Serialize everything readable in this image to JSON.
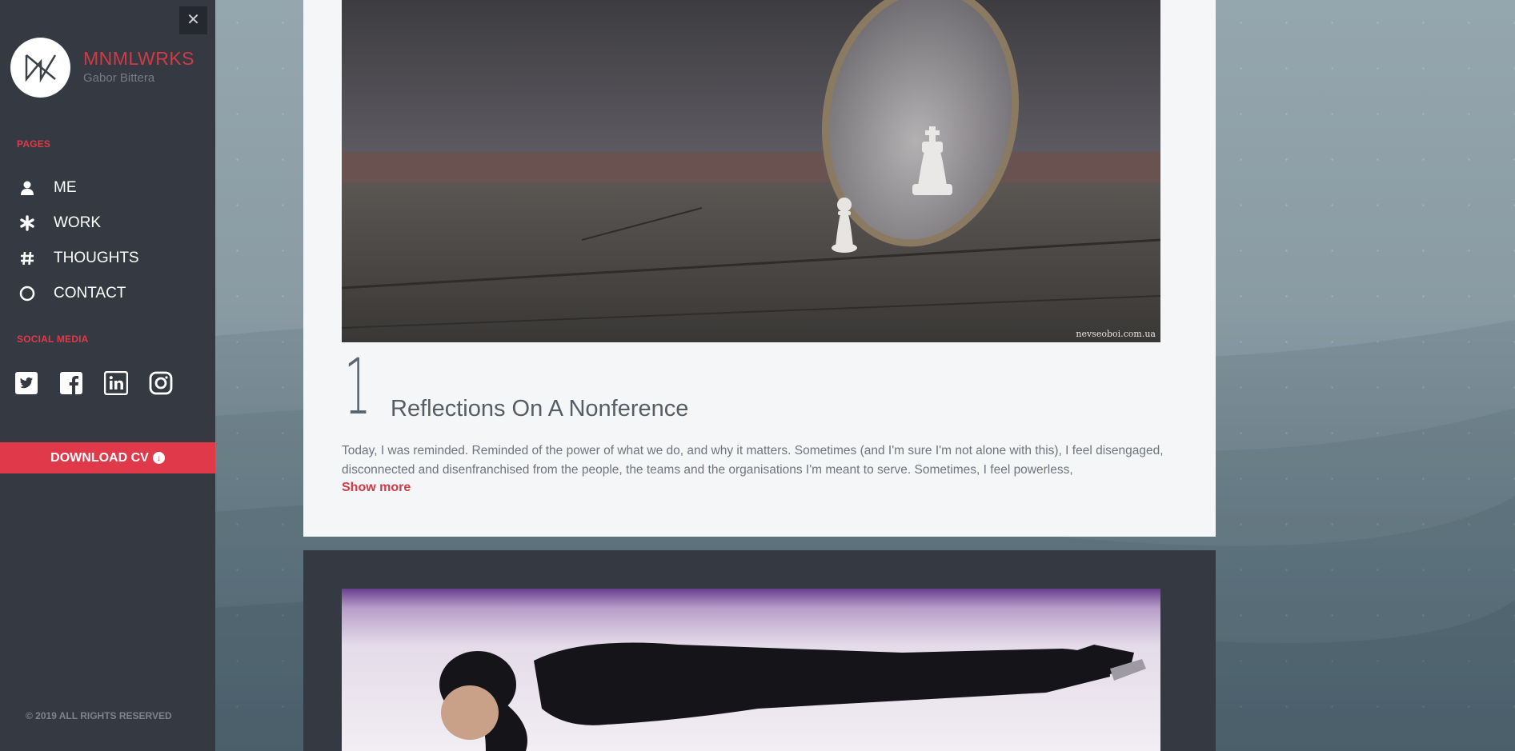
{
  "sidebar": {
    "brand_name": "MNMLWRKS",
    "brand_sub": "Gabor Bittera",
    "close_label": "✕",
    "pages_label": "PAGES",
    "nav": [
      {
        "label": "ME",
        "icon": "user-icon"
      },
      {
        "label": "WORK",
        "icon": "asterisk-icon"
      },
      {
        "label": "THOUGHTS",
        "icon": "hash-icon"
      },
      {
        "label": "CONTACT",
        "icon": "circle-icon"
      }
    ],
    "social_label": "SOCIAL MEDIA",
    "social": [
      "twitter-icon",
      "facebook-icon",
      "linkedin-icon",
      "instagram-icon"
    ],
    "download_label": "DOWNLOAD CV",
    "copyright": "© 2019 ALL RIGHTS RESERVED"
  },
  "post": {
    "number": "1",
    "title": "Reflections On A Nonference",
    "excerpt": "Today, I was reminded. Reminded of the power of what we do, and why it matters. Sometimes (and I'm sure I'm not alone with this), I feel disengaged, disconnected and disenfranchised from the people, the teams and the organisations I'm meant to serve. Sometimes, I feel powerless,",
    "show_more": "Show more",
    "image_credit": "nevseoboi.com.ua"
  },
  "colors": {
    "accent": "#e0394a",
    "sidebar_bg": "#353a42",
    "card_bg": "#f5f6f8"
  }
}
